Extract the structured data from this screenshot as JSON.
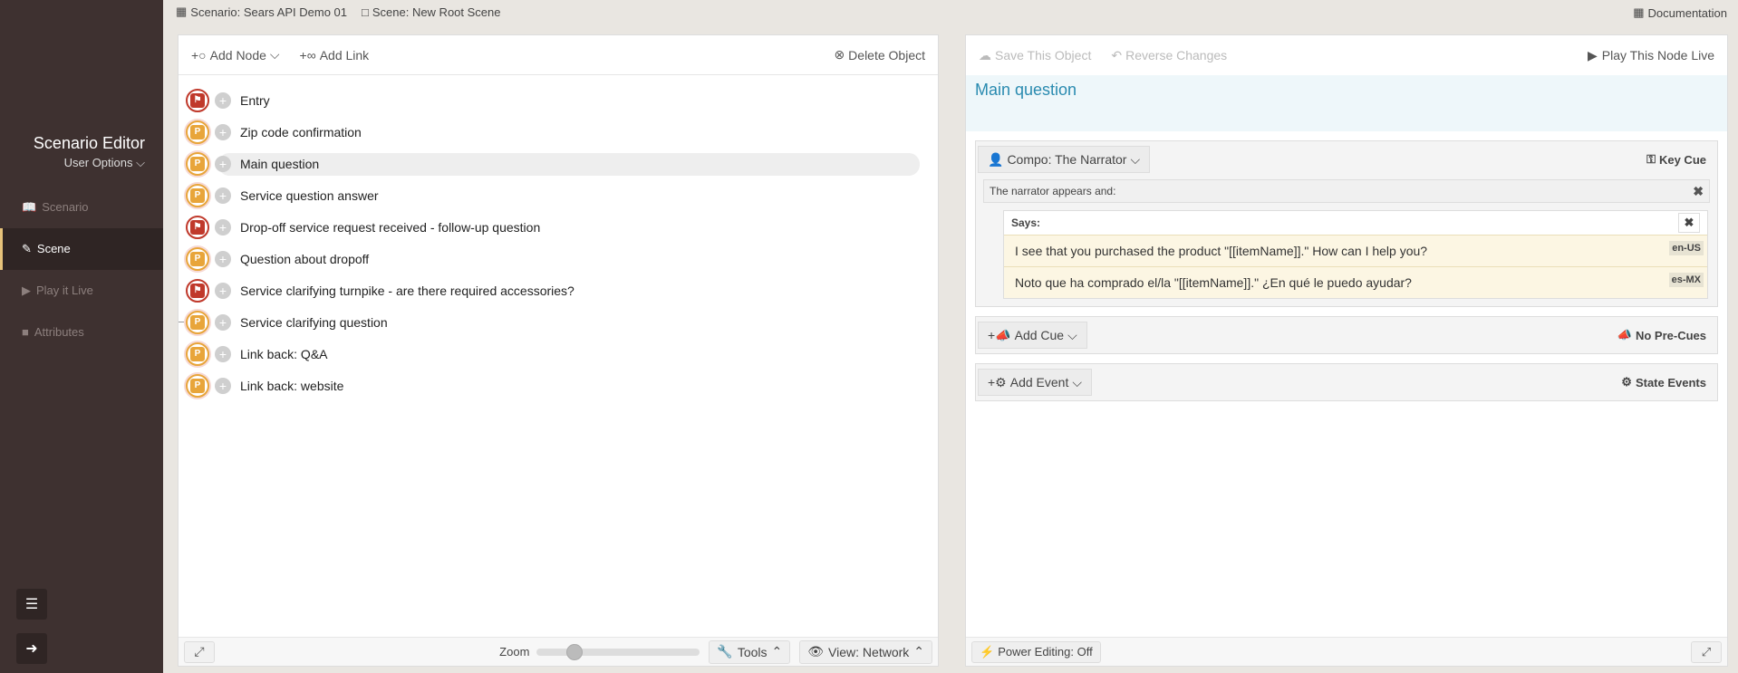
{
  "sidebar": {
    "title": "Scenario Editor",
    "user_options": "User Options",
    "items": [
      {
        "label": "Scenario",
        "icon": "book-icon"
      },
      {
        "label": "Scene",
        "icon": "pencil-icon"
      },
      {
        "label": "Play it Live",
        "icon": "play-icon"
      },
      {
        "label": "Attributes",
        "icon": "cube-icon"
      }
    ],
    "active_item": "Scene"
  },
  "topbar": {
    "scenario": "Scenario: Sears API Demo 01",
    "scene": "Scene: New Root Scene",
    "documentation": "Documentation"
  },
  "left_panel": {
    "add_node": "Add Node",
    "add_link": "Add Link",
    "delete_object": "Delete Object",
    "nodes": [
      {
        "label": "Entry",
        "type": "red"
      },
      {
        "label": "Zip code confirmation",
        "type": "orange"
      },
      {
        "label": "Main question",
        "type": "orange",
        "selected": true
      },
      {
        "label": "Service question answer",
        "type": "orange"
      },
      {
        "label": "Drop-off service request received - follow-up question",
        "type": "red"
      },
      {
        "label": "Question about dropoff",
        "type": "orange"
      },
      {
        "label": "Service clarifying turnpike - are there required accessories?",
        "type": "red"
      },
      {
        "label": "Service clarifying question",
        "type": "orange"
      },
      {
        "label": "Link back: Q&A",
        "type": "orange"
      },
      {
        "label": "Link back: website",
        "type": "orange"
      }
    ],
    "zoom_label": "Zoom",
    "zoom_level": 0.2,
    "tools": "Tools",
    "view": "View: Network"
  },
  "right_panel": {
    "save": "Save This Object",
    "reverse": "Reverse Changes",
    "play_node": "Play This Node Live",
    "title": "Main question",
    "compo": "Compo: The Narrator",
    "key_cue": "Key Cue",
    "narrator_appears": "The narrator appears and:",
    "says": "Says:",
    "lines": [
      {
        "text": "I see that you purchased the product \"[[itemName]].\" How can I help you?",
        "lang": "en-US"
      },
      {
        "text": "Noto que ha comprado el/la \"[[itemName]].\" ¿En qué le puedo ayudar?",
        "lang": "es-MX"
      }
    ],
    "add_cue": "Add Cue",
    "no_pre_cues": "No Pre-Cues",
    "add_event": "Add Event",
    "state_events": "State Events",
    "power_editing": "Power Editing: Off"
  }
}
